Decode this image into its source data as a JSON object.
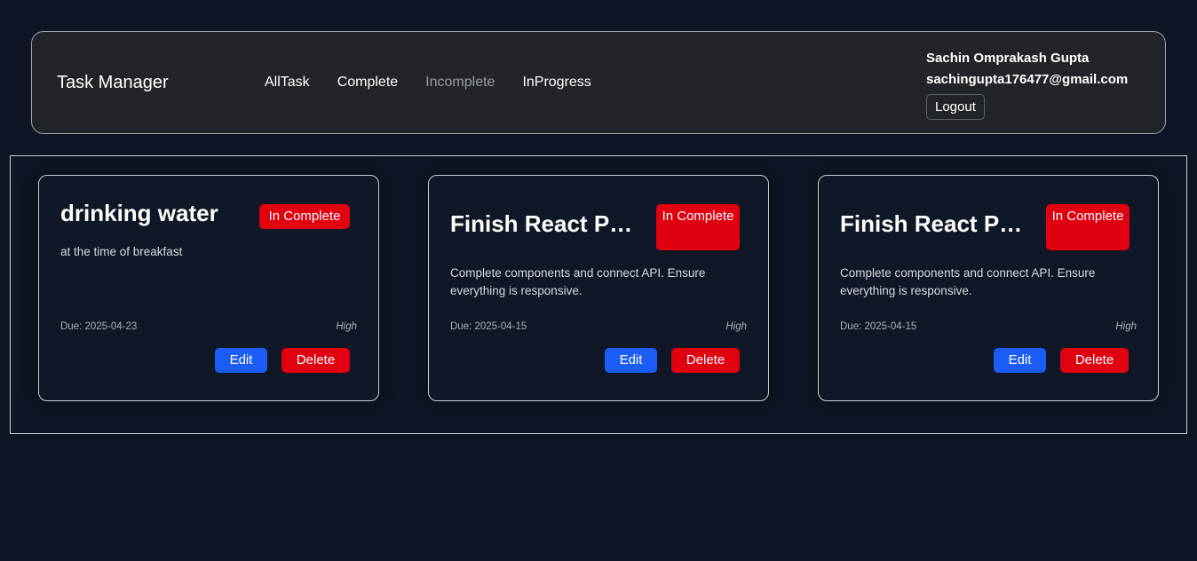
{
  "navbar": {
    "brand": "Task Manager",
    "links": [
      {
        "label": "AllTask"
      },
      {
        "label": "Complete"
      },
      {
        "label": "Incomplete"
      },
      {
        "label": "InProgress"
      }
    ],
    "user": {
      "name": "Sachin Omprakash Gupta",
      "email": "sachingupta176477@gmail.com",
      "logout_label": "Logout"
    }
  },
  "tasks": [
    {
      "title": "drinking water",
      "status": "In Complete",
      "description": "at the time of breakfast",
      "due": "Due: 2025-04-23",
      "priority": "High",
      "edit_label": "Edit",
      "delete_label": "Delete"
    },
    {
      "title": "Finish React Project",
      "status": "In Complete",
      "description": "Complete components and connect API. Ensure everything is responsive.",
      "due": "Due: 2025-04-15",
      "priority": "High",
      "edit_label": "Edit",
      "delete_label": "Delete"
    },
    {
      "title": "Finish React Project",
      "status": "In Complete",
      "description": "Complete components and connect API. Ensure everything is responsive.",
      "due": "Due: 2025-04-15",
      "priority": "High",
      "edit_label": "Edit",
      "delete_label": "Delete"
    }
  ],
  "colors": {
    "background": "#0f1524",
    "navbar": "#212529",
    "danger": "#e0000f",
    "primary": "#1a5cf5"
  }
}
